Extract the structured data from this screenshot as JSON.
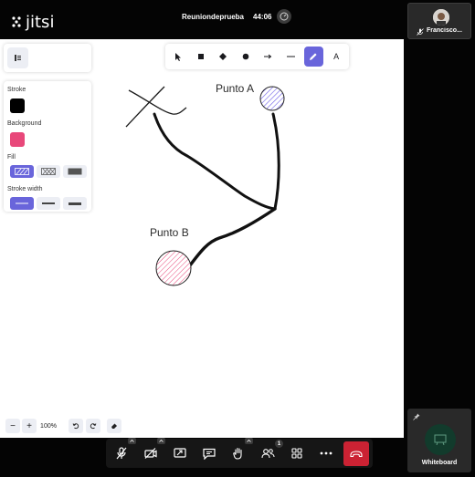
{
  "app": {
    "logo_text": "jitsi"
  },
  "header": {
    "meeting_name": "Reuniondeprueba",
    "timer": "44:06"
  },
  "whiteboard": {
    "properties": {
      "stroke_label": "Stroke",
      "stroke_color": "#000000",
      "background_label": "Background",
      "background_color": "#e8487a",
      "fill_label": "Fill",
      "stroke_width_label": "Stroke width"
    },
    "toolbar": {
      "text_tool_label": "A"
    },
    "zoom": {
      "minus": "−",
      "plus": "+",
      "level": "100%"
    },
    "canvas_labels": {
      "point_a": "Punto A",
      "point_b": "Punto B"
    },
    "colors": {
      "accent": "#6965db",
      "node_a": "#6b5ce7",
      "node_b": "#e8487a"
    }
  },
  "participants": {
    "top": {
      "name": "Francisco..."
    },
    "whiteboard_tile": {
      "name": "Whiteboard"
    }
  },
  "toolbar": {
    "participants_count": "1",
    "hangup_color": "#cb2233"
  }
}
